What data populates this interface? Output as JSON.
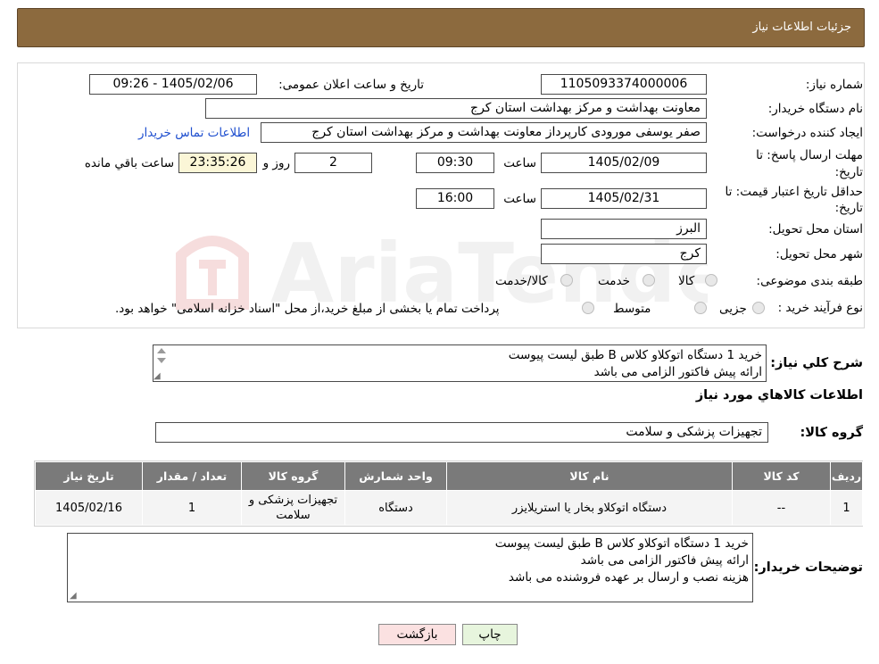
{
  "header": {
    "title": "جزئیات اطلاعات نیاز"
  },
  "form": {
    "need_number_label": "شماره نیاز:",
    "need_number": "1105093374000006",
    "announce_label": "تاریخ و ساعت اعلان عمومی:",
    "announce_value": "1405/02/06 - 09:26",
    "buyer_org_label": "نام دستگاه خریدار:",
    "buyer_org": "معاونت بهداشت و مرکز بهداشت استان کرج",
    "requester_label": "ایجاد کننده درخواست:",
    "requester": "صفر یوسفی مورودی کارپرداز معاونت بهداشت و مرکز بهداشت استان کرج",
    "contact_link": "اطلاعات تماس خریدار",
    "deadline_label_1": "مهلت ارسال پاسخ: تا",
    "deadline_label_2": "تاریخ:",
    "deadline_date": "1405/02/09",
    "time_label": "ساعت",
    "deadline_time": "09:30",
    "days_value": "2",
    "days_label": "روز و",
    "remaining_time": "23:35:26",
    "remaining_label": "ساعت باقي مانده",
    "validity_label_1": "حداقل تاریخ اعتبار قیمت: تا",
    "validity_label_2": "تاریخ:",
    "validity_date": "1405/02/31",
    "validity_time": "16:00",
    "province_label": "استان محل تحویل:",
    "province": "البرز",
    "city_label": "شهر محل تحویل:",
    "city": "کرج",
    "category_label": "طبقه بندی موضوعی:",
    "category_options": [
      "کالا",
      "خدمت",
      "کالا/خدمت"
    ],
    "purchase_type_label": "نوع فرآیند خرید :",
    "purchase_options": [
      "جزیی",
      "متوسط"
    ],
    "purchase_note": "پرداخت تمام یا بخشی از مبلغ خرید،از محل \"اسناد خزانه اسلامی\" خواهد بود."
  },
  "summary": {
    "label": "شرح کلي نياز:",
    "line1": "خرید 1 دستگاه اتوکلاو کلاس B طبق لیست پیوست",
    "line2": "ارائه پیش فاکتور الزامی می باشد"
  },
  "goods": {
    "section_title": "اطلاعات کالاهاي مورد نياز",
    "group_label": "گروه کالا:",
    "group_value": "تجهیزات پزشکی و سلامت",
    "columns": [
      "رديف",
      "کد کالا",
      "نام کالا",
      "واحد شمارش",
      "گروه کالا",
      "تعداد / مقدار",
      "تاریخ نیاز"
    ],
    "rows": [
      {
        "index": "1",
        "code": "--",
        "name": "دستگاه اتوکلاو بخار یا استریلایزر",
        "unit": "دستگاه",
        "group": "تجهیزات پزشکی و سلامت",
        "qty": "1",
        "date": "1405/02/16"
      }
    ]
  },
  "buyer_notes": {
    "label": "توضیحات خریدار:",
    "line1": "خرید 1 دستگاه اتوکلاو کلاس B طبق لیست پیوست",
    "line2": "ارائه پیش فاکتور الزامی می باشد",
    "line3": "هزینه نصب و ارسال بر عهده فروشنده می باشد"
  },
  "buttons": {
    "print": "چاپ",
    "back": "بازگشت"
  },
  "watermark": {
    "text": "AriaTender.neT"
  }
}
